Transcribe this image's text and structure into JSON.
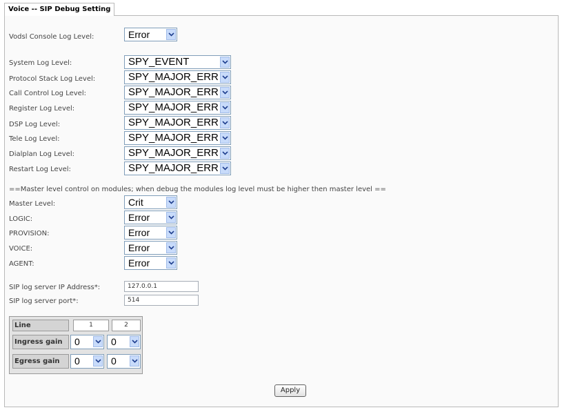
{
  "tab_title": "Voice -- SIP Debug Setting",
  "vodsl": {
    "label": "Vodsl Console Log Level:",
    "value": "Error"
  },
  "log_levels": [
    {
      "label": "System Log Level:",
      "value": "SPY_EVENT"
    },
    {
      "label": "Protocol Stack Log Level:",
      "value": "SPY_MAJOR_ERR"
    },
    {
      "label": "Call Control Log Level:",
      "value": "SPY_MAJOR_ERR"
    },
    {
      "label": "Register Log Level:",
      "value": "SPY_MAJOR_ERR"
    },
    {
      "label": "DSP Log Level:",
      "value": "SPY_MAJOR_ERR"
    },
    {
      "label": "Tele Log Level:",
      "value": "SPY_MAJOR_ERR"
    },
    {
      "label": "Dialplan Log Level:",
      "value": "SPY_MAJOR_ERR"
    },
    {
      "label": "Restart Log Level:",
      "value": "SPY_MAJOR_ERR"
    }
  ],
  "master_note": "==Master level control on modules; when debug the modules log level must be higher then master level ==",
  "modules": [
    {
      "label": "Master Level:",
      "value": "Crit"
    },
    {
      "label": "LOGIC:",
      "value": "Error"
    },
    {
      "label": "PROVISION:",
      "value": "Error"
    },
    {
      "label": "VOICE:",
      "value": "Error"
    },
    {
      "label": "AGENT:",
      "value": "Error"
    }
  ],
  "server": {
    "ip_label": "SIP log server IP Address*:",
    "ip_value": "127.0.0.1",
    "port_label": "SIP log server port*:",
    "port_value": "514"
  },
  "gain_table": {
    "line_label": "Line",
    "columns": [
      "1",
      "2"
    ],
    "ingress_label": "Ingress gain",
    "ingress_values": [
      "0",
      "0"
    ],
    "egress_label": "Egress gain",
    "egress_values": [
      "0",
      "0"
    ]
  },
  "apply_label": "Apply",
  "icons": {
    "dropdown": "chevron-down-icon"
  }
}
